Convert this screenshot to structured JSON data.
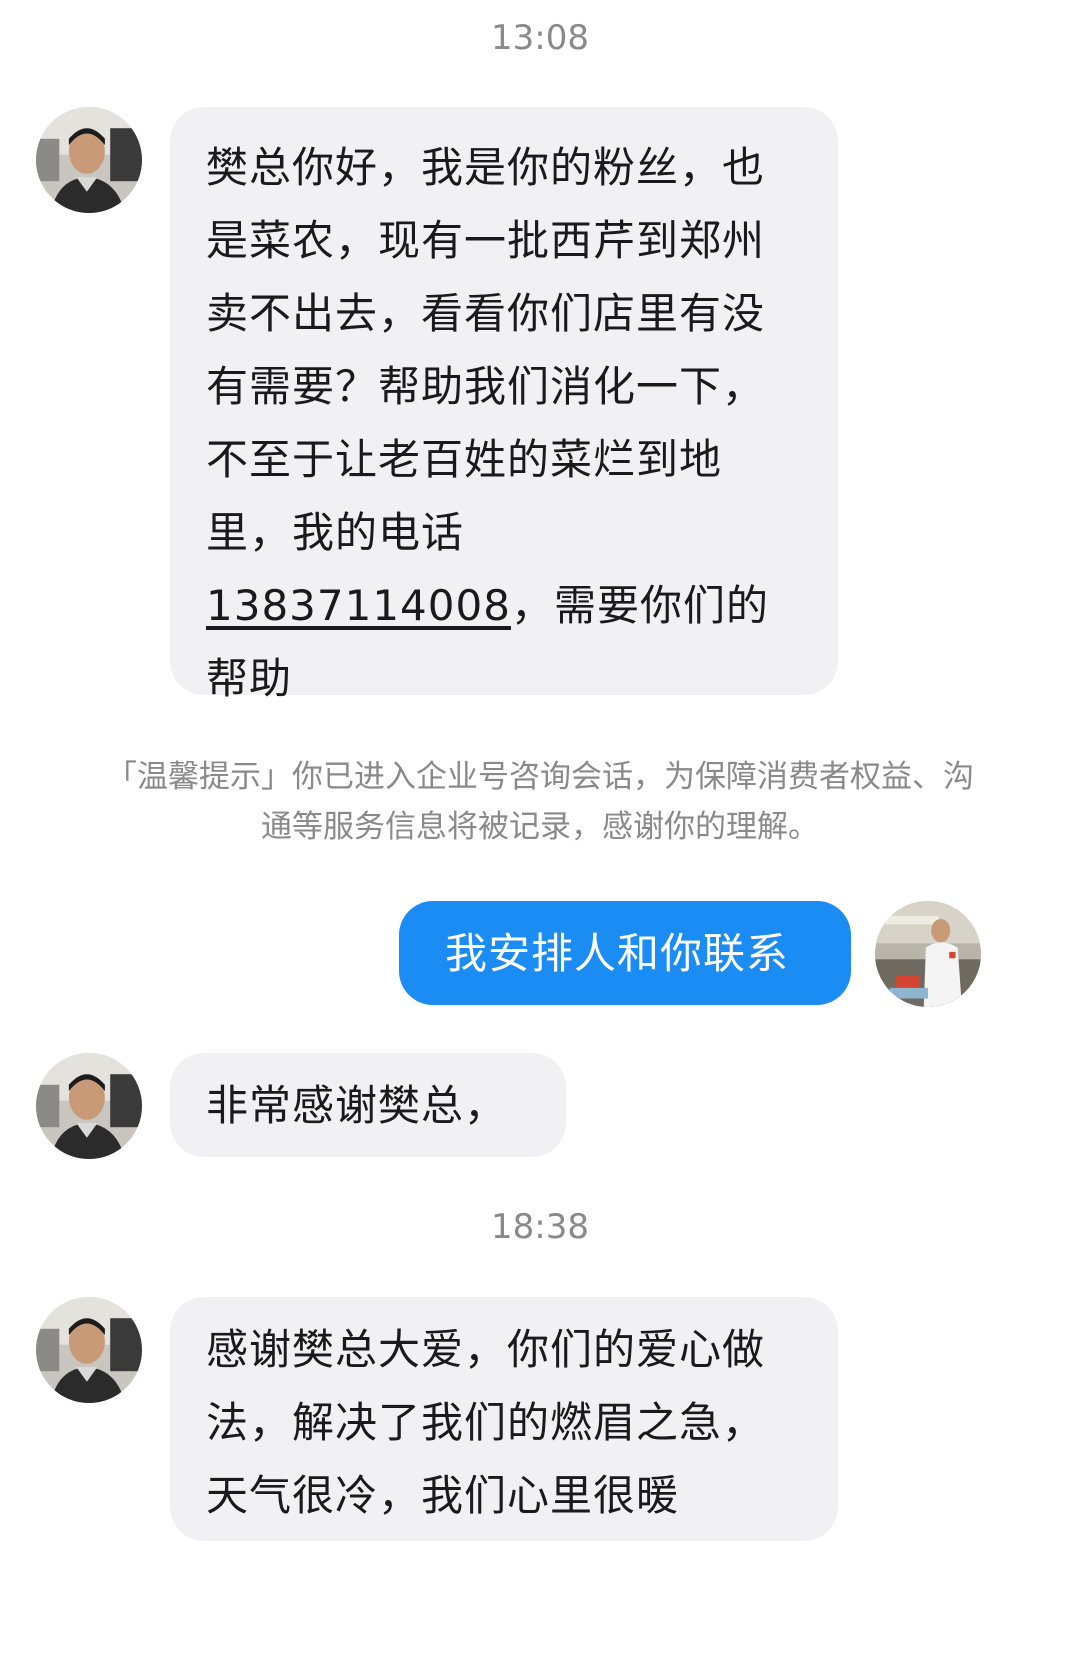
{
  "chat": {
    "timestamps": [
      "13:08",
      "18:38"
    ],
    "messages": [
      {
        "sender": "other",
        "lines": [
          "樊总你好，我是你的粉丝，也",
          "是菜农，现有一批西芹到郑州",
          "卖不出去，看看你们店里有没",
          "有需要？帮助我们消化一下，",
          "不至于让老百姓的菜烂到地",
          "里，我的电话"
        ],
        "phone": "13837114008",
        "after_phone": "，需要你们的",
        "last_line": "帮助"
      },
      {
        "sender": "other",
        "text": "非常感谢樊总，"
      },
      {
        "sender": "self",
        "text": "我安排人和你联系"
      },
      {
        "sender": "other",
        "lines": [
          "感谢樊总大爱，你们的爱心做",
          "法，解决了我们的燃眉之急，",
          "天气很冷，我们心里很暖"
        ]
      }
    ],
    "notice": "「温馨提示」你已进入企业号咨询会话，为保障消费者权益、沟通等服务信息将被记录，感谢你的理解。"
  },
  "colors": {
    "self_bubble": "#1b8cf3",
    "other_bubble": "#f1f1f3",
    "meta_text": "#8a8a8a"
  },
  "icons": {
    "other_avatar": "avatar-photo-man",
    "self_avatar": "avatar-photo-chef"
  }
}
